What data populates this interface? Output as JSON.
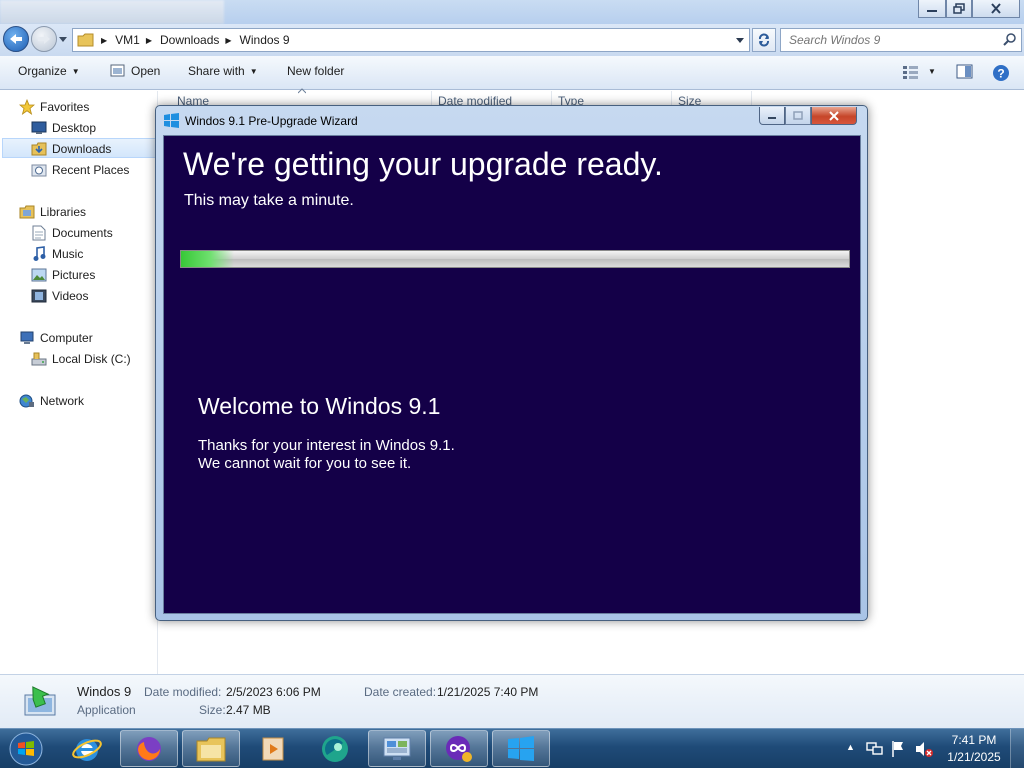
{
  "explorer": {
    "breadcrumb": [
      "VM1",
      "Downloads",
      "Windos 9"
    ],
    "search_placeholder": "Search Windos 9",
    "toolbar": {
      "organize": "Organize",
      "open": "Open",
      "share_with": "Share with",
      "new_folder": "New folder"
    },
    "nav": {
      "favorites": "Favorites",
      "desktop": "Desktop",
      "downloads": "Downloads",
      "recent_places": "Recent Places",
      "libraries": "Libraries",
      "documents": "Documents",
      "music": "Music",
      "pictures": "Pictures",
      "videos": "Videos",
      "computer": "Computer",
      "local_disk": "Local Disk (C:)",
      "network": "Network"
    },
    "columns": [
      "Name",
      "Date modified",
      "Type",
      "Size"
    ],
    "details": {
      "file_name": "Windos 9",
      "file_type": "Application",
      "date_modified_label": "Date modified:",
      "date_modified": "2/5/2023 6:06 PM",
      "date_created_label": "Date created:",
      "date_created": "1/21/2025 7:40 PM",
      "size_label": "Size:",
      "size": "2.47 MB"
    }
  },
  "wizard": {
    "title": "Windos 9.1 Pre-Upgrade Wizard",
    "heading": "We're getting your upgrade ready.",
    "subheading": "This may take a minute.",
    "progress_fraction": 0.08,
    "welcome_title": "Welcome to Windos 9.1",
    "welcome_line1": "Thanks for your interest in Windos 9.1.",
    "welcome_line2": "We cannot wait for you to see it.",
    "background_color": "#140048"
  },
  "taskbar": {
    "apps": [
      "internet-explorer-icon",
      "firefox-icon",
      "file-explorer-icon",
      "media-player-icon",
      "green-app-icon",
      "remote-desktop-icon",
      "purple-app-icon",
      "windows-logo-icon"
    ],
    "clock_time": "7:41 PM",
    "clock_date": "1/21/2025"
  }
}
